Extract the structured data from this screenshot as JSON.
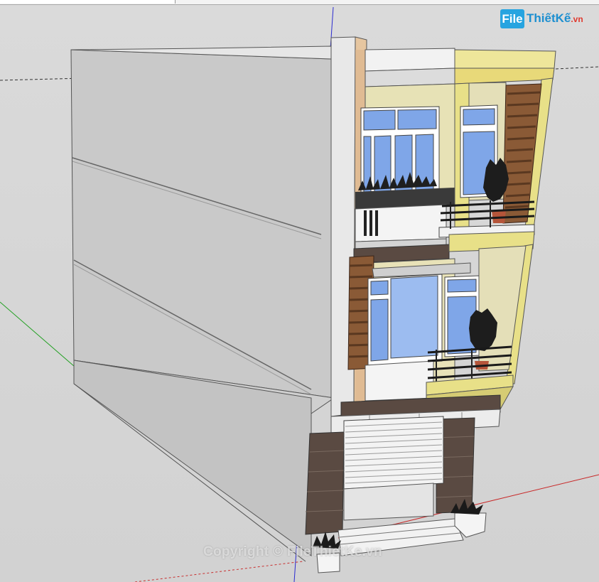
{
  "app": {
    "view": "3D model viewport",
    "toolbar_state": "collapsed"
  },
  "logo": {
    "box_text": "File",
    "word": "ThiếtKế",
    "suffix": ".vn"
  },
  "watermark": {
    "text": "Copyright © FileThietKe.vn"
  },
  "colors": {
    "background": "#d6d6d6",
    "axis_red": "#cc2020",
    "axis_green": "#20a020",
    "axis_blue": "#2020cc",
    "facade_yellow": "#e8e088",
    "glass_blue": "#7fa6e8",
    "stone_dark": "#5a4a42"
  }
}
